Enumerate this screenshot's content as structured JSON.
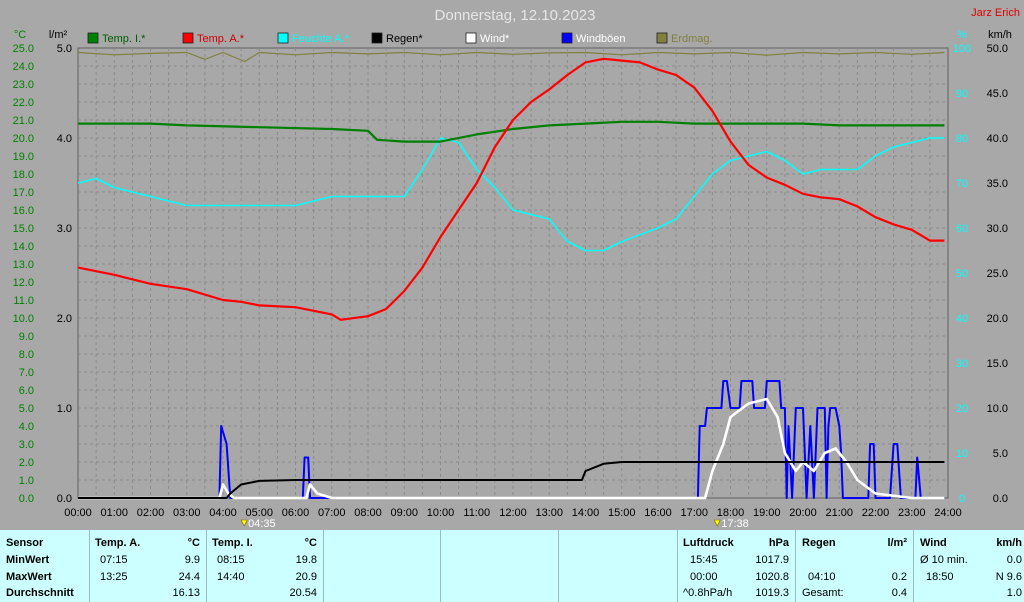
{
  "header": {
    "title": "Donnerstag, 12.10.2023",
    "author": "Jarz Erich"
  },
  "axes": {
    "left_unit_temp": "°C",
    "left_unit_rain": "l/m²",
    "right_unit_pct": "%",
    "right_unit_wind": "km/h"
  },
  "legend": [
    {
      "label": "Temp. I.*",
      "color": "#008000"
    },
    {
      "label": "Temp. A.*",
      "color": "#ff0000"
    },
    {
      "label": "Feuchte A.*",
      "color": "#00ffff"
    },
    {
      "label": "Regen*",
      "color": "#000000"
    },
    {
      "label": "Wind*",
      "color": "#ffffff"
    },
    {
      "label": "Windböen",
      "color": "#0000ff"
    },
    {
      "label": "Erdmag.",
      "color": "#808040"
    }
  ],
  "markers": {
    "sunrise": "04:35",
    "sunset": "17:38"
  },
  "chart_data": {
    "type": "line",
    "x_ticks": [
      "00:00",
      "01:00",
      "02:00",
      "03:00",
      "04:00",
      "05:00",
      "06:00",
      "07:00",
      "08:00",
      "09:00",
      "10:00",
      "11:00",
      "12:00",
      "13:00",
      "14:00",
      "15:00",
      "16:00",
      "17:00",
      "18:00",
      "19:00",
      "20:00",
      "21:00",
      "22:00",
      "23:00",
      "24:00"
    ],
    "temp_ticks": [
      "0.0",
      "1.0",
      "2.0",
      "3.0",
      "4.0",
      "5.0",
      "6.0",
      "7.0",
      "8.0",
      "9.0",
      "10.0",
      "11.0",
      "12.0",
      "13.0",
      "14.0",
      "15.0",
      "16.0",
      "17.0",
      "18.0",
      "19.0",
      "20.0",
      "21.0",
      "22.0",
      "23.0",
      "24.0",
      "25.0"
    ],
    "rain_ticks": [
      "0.0",
      "1.0",
      "2.0",
      "3.0",
      "4.0",
      "5.0"
    ],
    "pct_ticks": [
      "0",
      "10",
      "20",
      "30",
      "40",
      "50",
      "60",
      "70",
      "80",
      "90",
      "100"
    ],
    "wind_ticks": [
      "0.0",
      "5.0",
      "10.0",
      "15.0",
      "20.0",
      "25.0",
      "30.0",
      "35.0",
      "40.0",
      "45.0",
      "50.0"
    ],
    "ylim_temp": [
      0,
      25
    ],
    "ylim_rain": [
      0,
      5
    ],
    "ylim_pct": [
      0,
      100
    ],
    "ylim_wind": [
      0,
      50
    ],
    "xlim_hours": [
      0,
      24
    ],
    "series": [
      {
        "name": "Temp. I.*",
        "axis": "temp",
        "color": "#008000",
        "points": [
          [
            0,
            20.8
          ],
          [
            2,
            20.8
          ],
          [
            3,
            20.7
          ],
          [
            5,
            20.6
          ],
          [
            7,
            20.5
          ],
          [
            8,
            20.4
          ],
          [
            8.25,
            19.9
          ],
          [
            9,
            19.8
          ],
          [
            10,
            19.8
          ],
          [
            11,
            20.2
          ],
          [
            12,
            20.5
          ],
          [
            13,
            20.7
          ],
          [
            14,
            20.8
          ],
          [
            15,
            20.9
          ],
          [
            16,
            20.9
          ],
          [
            17,
            20.8
          ],
          [
            18,
            20.8
          ],
          [
            20,
            20.8
          ],
          [
            21,
            20.7
          ],
          [
            22,
            20.7
          ],
          [
            23.9,
            20.7
          ]
        ]
      },
      {
        "name": "Temp. A.*",
        "axis": "temp",
        "color": "#ff0000",
        "points": [
          [
            0,
            12.8
          ],
          [
            1,
            12.4
          ],
          [
            2,
            11.9
          ],
          [
            3,
            11.6
          ],
          [
            4,
            11.0
          ],
          [
            4.5,
            10.9
          ],
          [
            5,
            10.7
          ],
          [
            6,
            10.6
          ],
          [
            7,
            10.2
          ],
          [
            7.25,
            9.9
          ],
          [
            8,
            10.1
          ],
          [
            8.5,
            10.5
          ],
          [
            9,
            11.5
          ],
          [
            9.5,
            12.8
          ],
          [
            10,
            14.5
          ],
          [
            10.5,
            16.0
          ],
          [
            11,
            17.5
          ],
          [
            11.5,
            19.5
          ],
          [
            12,
            21.0
          ],
          [
            12.5,
            22.0
          ],
          [
            13,
            22.7
          ],
          [
            13.5,
            23.5
          ],
          [
            14,
            24.2
          ],
          [
            14.5,
            24.4
          ],
          [
            15,
            24.3
          ],
          [
            15.5,
            24.2
          ],
          [
            16,
            23.8
          ],
          [
            16.5,
            23.5
          ],
          [
            17,
            22.8
          ],
          [
            17.5,
            21.5
          ],
          [
            18,
            19.8
          ],
          [
            18.5,
            18.5
          ],
          [
            19,
            17.8
          ],
          [
            19.5,
            17.4
          ],
          [
            20,
            16.9
          ],
          [
            20.5,
            16.7
          ],
          [
            21,
            16.6
          ],
          [
            21.5,
            16.2
          ],
          [
            22,
            15.6
          ],
          [
            22.5,
            15.2
          ],
          [
            23,
            14.9
          ],
          [
            23.5,
            14.3
          ],
          [
            23.9,
            14.3
          ]
        ]
      },
      {
        "name": "Feuchte A.*",
        "axis": "pct",
        "color": "#00ffff",
        "points": [
          [
            0,
            70
          ],
          [
            0.5,
            71
          ],
          [
            1,
            69
          ],
          [
            2,
            67
          ],
          [
            3,
            65
          ],
          [
            4,
            65
          ],
          [
            5,
            65
          ],
          [
            6,
            65
          ],
          [
            7,
            67
          ],
          [
            8,
            67
          ],
          [
            9,
            67
          ],
          [
            9.5,
            73
          ],
          [
            10,
            80
          ],
          [
            10.5,
            79
          ],
          [
            11,
            73
          ],
          [
            11.5,
            69
          ],
          [
            12,
            64
          ],
          [
            13,
            62
          ],
          [
            13.5,
            57
          ],
          [
            14,
            55
          ],
          [
            14.5,
            55
          ],
          [
            15,
            57
          ],
          [
            16,
            60
          ],
          [
            16.5,
            62
          ],
          [
            17,
            67
          ],
          [
            17.5,
            72
          ],
          [
            18,
            75
          ],
          [
            18.5,
            76
          ],
          [
            19,
            77
          ],
          [
            19.5,
            75
          ],
          [
            20,
            72
          ],
          [
            20.5,
            73
          ],
          [
            21,
            73
          ],
          [
            21.5,
            73
          ],
          [
            22,
            76
          ],
          [
            22.5,
            78
          ],
          [
            23,
            79
          ],
          [
            23.5,
            80
          ],
          [
            23.9,
            80
          ]
        ]
      },
      {
        "name": "Regen*",
        "axis": "rain",
        "color": "#000000",
        "points": [
          [
            0,
            0
          ],
          [
            4.1,
            0
          ],
          [
            4.2,
            0.05
          ],
          [
            4.5,
            0.15
          ],
          [
            5,
            0.19
          ],
          [
            6,
            0.2
          ],
          [
            13.9,
            0.2
          ],
          [
            14.0,
            0.3
          ],
          [
            14.5,
            0.38
          ],
          [
            15,
            0.4
          ],
          [
            23.9,
            0.4
          ]
        ]
      },
      {
        "name": "Wind*",
        "axis": "wind",
        "color": "#ffffff",
        "points": [
          [
            0,
            0
          ],
          [
            3.9,
            0
          ],
          [
            4.0,
            1.5
          ],
          [
            4.15,
            0.5
          ],
          [
            4.3,
            0
          ],
          [
            6.3,
            0
          ],
          [
            6.4,
            1.5
          ],
          [
            6.6,
            0.5
          ],
          [
            7,
            0
          ],
          [
            17.3,
            0
          ],
          [
            17.5,
            3
          ],
          [
            17.8,
            6
          ],
          [
            18,
            9
          ],
          [
            18.5,
            10.5
          ],
          [
            19,
            11
          ],
          [
            19.3,
            9
          ],
          [
            19.5,
            5
          ],
          [
            19.8,
            3
          ],
          [
            20,
            4
          ],
          [
            20.3,
            3
          ],
          [
            20.6,
            5
          ],
          [
            20.9,
            5.5
          ],
          [
            21.2,
            4
          ],
          [
            21.5,
            2
          ],
          [
            22,
            0.5
          ],
          [
            23,
            0
          ],
          [
            23.9,
            0
          ]
        ]
      },
      {
        "name": "Windböen",
        "axis": "wind",
        "color": "#0000ff",
        "points": [
          [
            0,
            0
          ],
          [
            3.9,
            0
          ],
          [
            3.95,
            8
          ],
          [
            4.1,
            6
          ],
          [
            4.2,
            0
          ],
          [
            6.2,
            0
          ],
          [
            6.25,
            4.5
          ],
          [
            6.35,
            4.5
          ],
          [
            6.4,
            0
          ],
          [
            17.1,
            0
          ],
          [
            17.15,
            8
          ],
          [
            17.3,
            8
          ],
          [
            17.35,
            10
          ],
          [
            17.75,
            10
          ],
          [
            17.8,
            13
          ],
          [
            17.9,
            13
          ],
          [
            18,
            10
          ],
          [
            18.25,
            10
          ],
          [
            18.3,
            13
          ],
          [
            18.6,
            13
          ],
          [
            18.65,
            10
          ],
          [
            18.95,
            10
          ],
          [
            19,
            13
          ],
          [
            19.35,
            13
          ],
          [
            19.4,
            10
          ],
          [
            19.5,
            10
          ],
          [
            19.55,
            0
          ],
          [
            19.6,
            8
          ],
          [
            19.7,
            0
          ],
          [
            19.8,
            10
          ],
          [
            20,
            10
          ],
          [
            20.1,
            0
          ],
          [
            20.2,
            8
          ],
          [
            20.3,
            0
          ],
          [
            20.4,
            10
          ],
          [
            20.6,
            10
          ],
          [
            20.65,
            0
          ],
          [
            20.7,
            8
          ],
          [
            20.75,
            10
          ],
          [
            20.9,
            10
          ],
          [
            21,
            8
          ],
          [
            21.05,
            5
          ],
          [
            21.1,
            0
          ],
          [
            21.8,
            0
          ],
          [
            21.85,
            6
          ],
          [
            21.95,
            6
          ],
          [
            22.0,
            0
          ],
          [
            22.4,
            0
          ],
          [
            22.5,
            6
          ],
          [
            22.6,
            6
          ],
          [
            22.7,
            0
          ],
          [
            23.1,
            0
          ],
          [
            23.15,
            4.5
          ],
          [
            23.25,
            0
          ],
          [
            23.9,
            0
          ]
        ]
      },
      {
        "name": "Erdmag.",
        "axis": "pct",
        "color": "#808040",
        "points": [
          [
            0,
            99
          ],
          [
            1,
            98.5
          ],
          [
            2,
            98.8
          ],
          [
            3,
            99
          ],
          [
            3.5,
            97.5
          ],
          [
            4,
            99
          ],
          [
            4.6,
            97
          ],
          [
            5,
            99
          ],
          [
            6,
            98.5
          ],
          [
            7,
            99
          ],
          [
            8,
            98.7
          ],
          [
            9,
            99
          ],
          [
            10,
            98.5
          ],
          [
            11,
            99
          ],
          [
            12,
            98.6
          ],
          [
            13,
            98.9
          ],
          [
            14,
            99
          ],
          [
            15,
            98.5
          ],
          [
            16,
            99
          ],
          [
            17,
            98.7
          ],
          [
            18,
            99
          ],
          [
            19,
            98.4
          ],
          [
            20,
            99
          ],
          [
            21,
            98.7
          ],
          [
            22,
            99
          ],
          [
            23,
            98.6
          ],
          [
            23.9,
            99
          ]
        ]
      }
    ]
  },
  "table": {
    "row_labels": [
      "Sensor",
      "MinWert",
      "MaxWert",
      "Durchschnitt"
    ],
    "temp_a": {
      "header": "Temp. A.",
      "unit": "°C",
      "rows": [
        [
          "07:15",
          "9.9"
        ],
        [
          "13:25",
          "24.4"
        ],
        [
          "",
          "16.13"
        ]
      ]
    },
    "temp_i": {
      "header": "Temp. I.",
      "unit": "°C",
      "rows": [
        [
          "08:15",
          "19.8"
        ],
        [
          "14:40",
          "20.9"
        ],
        [
          "",
          "20.54"
        ]
      ]
    },
    "luftdruck": {
      "header": "Luftdruck",
      "unit": "hPa",
      "rows": [
        [
          "15:45",
          "1017.9"
        ],
        [
          "00:00",
          "1020.8"
        ],
        [
          "^0.8hPa/h",
          "1019.3"
        ]
      ]
    },
    "regen": {
      "header": "Regen",
      "unit": "l/m²",
      "rows": [
        [
          "",
          ""
        ],
        [
          "04:10",
          "0.2"
        ],
        [
          "Gesamt:",
          "0.4"
        ]
      ]
    },
    "wind": {
      "header": "Wind",
      "unit": "km/h",
      "rows": [
        [
          "Ø 10 min.",
          "0.0"
        ],
        [
          "18:50",
          "N 9.6"
        ],
        [
          "",
          "1.0"
        ]
      ]
    }
  }
}
